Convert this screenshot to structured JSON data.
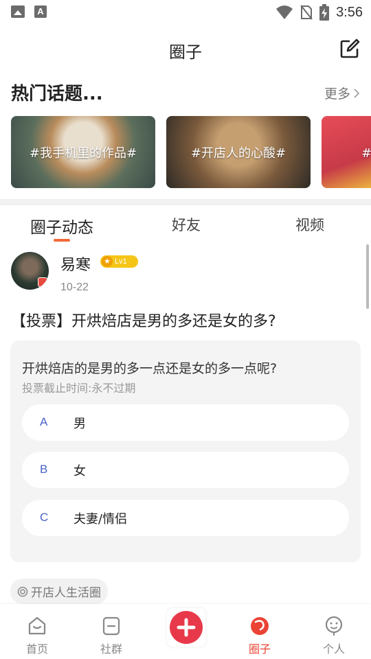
{
  "status_bar": {
    "time": "3:56",
    "icons": [
      "image-icon",
      "text-a-icon",
      "wifi-icon",
      "no-sim-icon",
      "battery-charging-icon"
    ]
  },
  "titlebar": {
    "title": "圈子",
    "edit_icon": "edit-icon"
  },
  "hot_topics": {
    "title": "热门话题...",
    "more": "更多",
    "items": [
      {
        "label": "#我手机里的作品#"
      },
      {
        "label": "#开店人的心酸#"
      },
      {
        "label": "#美"
      }
    ]
  },
  "tabs": [
    {
      "label": "圈子动态",
      "active": true
    },
    {
      "label": "好友",
      "active": false
    },
    {
      "label": "视频",
      "active": false
    }
  ],
  "post": {
    "username": "易寒",
    "level": "Lv1",
    "date": "10-22",
    "title": "【投票】开烘焙店是男的多还是女的多?",
    "vote": {
      "question": "开烘焙店的是男的多一点还是女的多一点呢?",
      "deadline": "投票截止时间:永不过期",
      "options": [
        {
          "letter": "A",
          "text": "男"
        },
        {
          "letter": "B",
          "text": "女"
        },
        {
          "letter": "C",
          "text": "夫妻/情侣"
        }
      ]
    },
    "circle_tag": "开店人生活圈"
  },
  "bottom_nav": [
    {
      "label": "首页",
      "icon": "home-icon",
      "active": false
    },
    {
      "label": "社群",
      "icon": "community-icon",
      "active": false
    },
    {
      "label": "",
      "icon": "plus-icon",
      "active": false
    },
    {
      "label": "圈子",
      "icon": "circle-icon",
      "active": true
    },
    {
      "label": "个人",
      "icon": "profile-icon",
      "active": false
    }
  ],
  "colors": {
    "accent": "#f26b3a",
    "nav_active": "#ea4335",
    "vote_letter": "#4a63c9",
    "level_badge": "#f5c518"
  }
}
